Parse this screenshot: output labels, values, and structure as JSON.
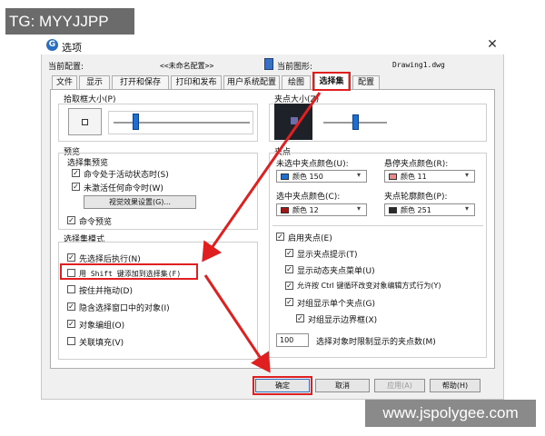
{
  "watermark": {
    "top_left": "TG: MYYJJPP",
    "bottom_right": "www.jspolygee.com"
  },
  "window": {
    "icon_letter": "G",
    "title": "选项"
  },
  "profile": {
    "current_profile_label": "当前配置:",
    "current_profile_value": "<<未命名配置>>",
    "current_drawing_label": "当前图形:",
    "current_drawing_value": "Drawing1.dwg"
  },
  "tabs": [
    "文件",
    "显示",
    "打开和保存",
    "打印和发布",
    "用户系统配置",
    "绘图",
    "选择集",
    "配置"
  ],
  "active_tab": "选择集",
  "pickbox": {
    "title": "拾取框大小(P)"
  },
  "preview": {
    "title": "预览",
    "subtitle": "选择集预览",
    "options": [
      {
        "label": "命令处于活动状态时(S)",
        "checked": true
      },
      {
        "label": "未激活任何命令时(W)",
        "checked": true
      }
    ],
    "visual_effects_button": "视觉效果设置(G)...",
    "command_preview": {
      "label": "命令预览",
      "checked": true
    }
  },
  "selection_modes": {
    "title": "选择集模式",
    "options": [
      {
        "label": "先选择后执行(N)",
        "checked": true
      },
      {
        "label": "用 Shift 键添加到选择集(F)",
        "checked": false
      },
      {
        "label": "按住并拖动(D)",
        "checked": false
      },
      {
        "label": "隐含选择窗口中的对象(I)",
        "checked": true
      },
      {
        "label": "对象编组(O)",
        "checked": true
      },
      {
        "label": "关联填充(V)",
        "checked": false
      }
    ]
  },
  "grip_size": {
    "title": "夹点大小(Z)"
  },
  "grips": {
    "title": "夹点",
    "unselected_label": "未选中夹点颜色(U):",
    "unselected_value": "颜色 150",
    "unselected_color": "#1e6fd0",
    "hover_label": "悬停夹点颜色(R):",
    "hover_value": "颜色 11",
    "hover_color": "#ee8888",
    "selected_label": "选中夹点颜色(C):",
    "selected_value": "颜色 12",
    "selected_color": "#a01818",
    "contour_label": "夹点轮廓颜色(P):",
    "contour_value": "颜色 251",
    "contour_color": "#2a2a2a",
    "options": [
      {
        "label": "启用夹点(E)",
        "checked": true
      },
      {
        "label": "显示夹点提示(T)",
        "checked": true
      },
      {
        "label": "显示动态夹点菜单(U)",
        "checked": true
      },
      {
        "label": "允许按 Ctrl 键循环改变对象编辑方式行为(Y)",
        "checked": true
      },
      {
        "label": "对组显示单个夹点(G)",
        "checked": true
      },
      {
        "label": "对组显示边界框(X)",
        "checked": true
      }
    ],
    "limit_value": "100",
    "limit_label": "选择对象时限制显示的夹点数(M)"
  },
  "buttons": {
    "ok": "确定",
    "cancel": "取消",
    "apply": "应用(A)",
    "help": "帮助(H)"
  },
  "colors": {
    "highlight_red": "#e02020",
    "accent_blue": "#1e6fd0"
  }
}
